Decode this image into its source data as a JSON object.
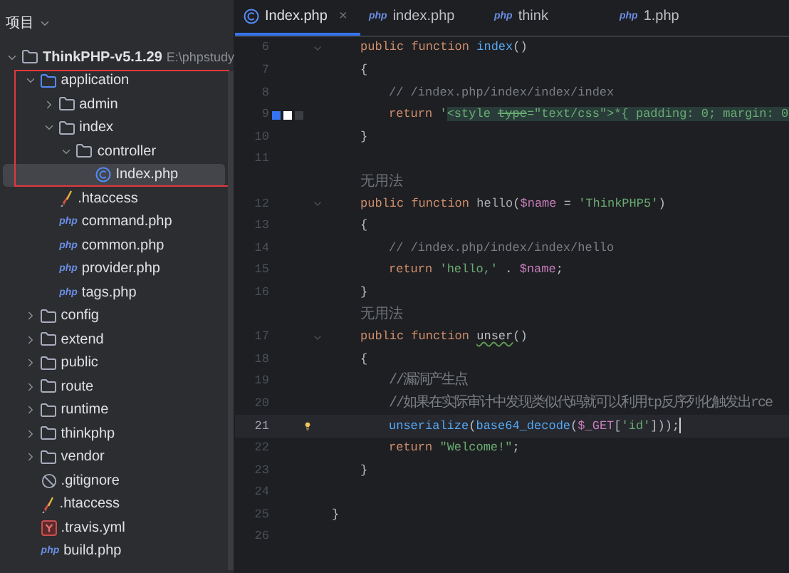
{
  "project_panel": {
    "title": "项目"
  },
  "tree": [
    {
      "label": "ThinkPHP-v5.1.29",
      "path": "E:\\phpstudy",
      "kind": "folder",
      "expanded": true,
      "children": [
        {
          "label": "application",
          "kind": "module",
          "expanded": true,
          "children": [
            {
              "label": "admin",
              "kind": "folder",
              "expanded": false
            },
            {
              "label": "index",
              "kind": "folder",
              "expanded": true,
              "children": [
                {
                  "label": "controller",
                  "kind": "folder",
                  "expanded": true,
                  "children": [
                    {
                      "label": "Index.php",
                      "kind": "class",
                      "selected": true
                    }
                  ]
                }
              ]
            },
            {
              "label": ".htaccess",
              "kind": "htaccess",
              "selected": false
            },
            {
              "label": "command.php",
              "kind": "php",
              "icon_label": "php",
              "selected": false
            },
            {
              "label": "common.php",
              "kind": "php",
              "icon_label": "php",
              "selected": false
            },
            {
              "label": "provider.php",
              "kind": "php",
              "icon_label": "php",
              "selected": false
            },
            {
              "label": "tags.php",
              "kind": "php",
              "icon_label": "php",
              "selected": false
            }
          ]
        },
        {
          "label": "config",
          "kind": "folder",
          "expanded": false
        },
        {
          "label": "extend",
          "kind": "folder",
          "expanded": false
        },
        {
          "label": "public",
          "kind": "folder",
          "expanded": false
        },
        {
          "label": "route",
          "kind": "folder",
          "expanded": false
        },
        {
          "label": "runtime",
          "kind": "folder",
          "expanded": false
        },
        {
          "label": "thinkphp",
          "kind": "folder",
          "expanded": false
        },
        {
          "label": "vendor",
          "kind": "folder",
          "expanded": false
        },
        {
          "label": ".gitignore",
          "kind": "gitignore",
          "selected": false
        },
        {
          "label": ".htaccess",
          "kind": "htaccess",
          "selected": false
        },
        {
          "label": ".travis.yml",
          "kind": "yml",
          "selected": false
        },
        {
          "label": "build.php",
          "kind": "php",
          "icon_label": "php",
          "selected": false
        }
      ]
    }
  ],
  "tabs": [
    {
      "label": "Index.php",
      "kind": "class",
      "selected": true,
      "close": "×"
    },
    {
      "label": "index.php",
      "kind": "php",
      "icon_label": "php",
      "selected": false
    },
    {
      "label": "think",
      "kind": "php",
      "icon_label": "php",
      "selected": false
    },
    {
      "label": "1.php",
      "kind": "php",
      "icon_label": "php",
      "selected": false
    }
  ],
  "code": [
    {
      "kind": "member",
      "number": "6",
      "fold": true,
      "tokens": [
        {
          "text": "public function ",
          "kind": "kw"
        },
        {
          "text": "index",
          "kind": "fn"
        },
        {
          "text": "()",
          "kind": "plain"
        }
      ]
    },
    {
      "kind": "member",
      "number": "7",
      "tokens": [
        {
          "text": "{",
          "kind": "plain"
        }
      ]
    },
    {
      "kind": "body",
      "number": "8",
      "tokens": [
        {
          "text": "// /index.php/index/index/index",
          "kind": "cmt"
        }
      ]
    },
    {
      "kind": "body",
      "number": "9",
      "gutter": {
        "kind": "swatches"
      },
      "tokens": [
        {
          "text": "return ",
          "kind": "kw"
        },
        {
          "text": "'",
          "kind": "str"
        },
        {
          "text": "<style ",
          "kind": "markup"
        },
        {
          "text": "type",
          "kind": "deprecated"
        },
        {
          "text": "=\"text/css\">*{ padding: 0; margin: 0",
          "kind": "markup"
        }
      ]
    },
    {
      "kind": "member",
      "number": "10",
      "tokens": [
        {
          "text": "}",
          "kind": "plain"
        }
      ]
    },
    {
      "number": "11"
    },
    {
      "kind": "hint",
      "tokens": [
        {
          "text": "无用法",
          "kind": "hint"
        }
      ]
    },
    {
      "kind": "member",
      "number": "12",
      "fold": true,
      "tokens": [
        {
          "text": "public function ",
          "kind": "kw"
        },
        {
          "text": "hello",
          "kind": "unused"
        },
        {
          "text": "(",
          "kind": "plain"
        },
        {
          "text": "$name",
          "kind": "var"
        },
        {
          "text": " = ",
          "kind": "plain"
        },
        {
          "text": "'ThinkPHP5'",
          "kind": "str"
        },
        {
          "text": ")",
          "kind": "plain"
        }
      ]
    },
    {
      "kind": "member",
      "number": "13",
      "tokens": [
        {
          "text": "{",
          "kind": "plain"
        }
      ]
    },
    {
      "kind": "body",
      "number": "14",
      "tokens": [
        {
          "text": "// /index.php/index/index/hello",
          "kind": "cmt"
        }
      ]
    },
    {
      "kind": "body",
      "number": "15",
      "tokens": [
        {
          "text": "return ",
          "kind": "kw"
        },
        {
          "text": "'hello,'",
          "kind": "str"
        },
        {
          "text": " . ",
          "kind": "plain"
        },
        {
          "text": "$name",
          "kind": "var"
        },
        {
          "text": ";",
          "kind": "plain"
        }
      ]
    },
    {
      "kind": "member",
      "number": "16",
      "tokens": [
        {
          "text": "}",
          "kind": "plain"
        }
      ]
    },
    {
      "kind": "hint",
      "tokens": [
        {
          "text": "无用法",
          "kind": "hint"
        }
      ]
    },
    {
      "kind": "member",
      "number": "17",
      "fold": true,
      "tokens": [
        {
          "text": "public function ",
          "kind": "kw"
        },
        {
          "text": "unser",
          "kind": "warn"
        },
        {
          "text": "()",
          "kind": "plain"
        }
      ]
    },
    {
      "kind": "member",
      "number": "18",
      "tokens": [
        {
          "text": "{",
          "kind": "plain"
        }
      ]
    },
    {
      "kind": "body",
      "number": "19",
      "tokens": [
        {
          "text": "//漏洞产生点",
          "kind": "note"
        }
      ]
    },
    {
      "kind": "body",
      "number": "20",
      "tokens": [
        {
          "text": "//如果在实际审计中发现类似代码就可以利用tp反序列化触发出rce",
          "kind": "note"
        }
      ]
    },
    {
      "kind": "body",
      "number": "21",
      "current": true,
      "gutter": {
        "kind": "bulb"
      },
      "tokens": [
        {
          "text": "unserialize",
          "kind": "call"
        },
        {
          "text": "(",
          "kind": "plain"
        },
        {
          "text": "base64_decode",
          "kind": "call"
        },
        {
          "text": "(",
          "kind": "plain"
        },
        {
          "text": "$_GET",
          "kind": "var"
        },
        {
          "text": "[",
          "kind": "plain"
        },
        {
          "text": "'id'",
          "kind": "str"
        },
        {
          "text": "]));",
          "kind": "plain"
        }
      ]
    },
    {
      "kind": "body",
      "number": "22",
      "tokens": [
        {
          "text": "return ",
          "kind": "kw"
        },
        {
          "text": "\"Welcome!\"",
          "kind": "str"
        },
        {
          "text": ";",
          "kind": "plain"
        }
      ]
    },
    {
      "kind": "member",
      "number": "23",
      "tokens": [
        {
          "text": "}",
          "kind": "plain"
        }
      ]
    },
    {
      "number": "24"
    },
    {
      "kind": "top",
      "number": "25",
      "tokens": [
        {
          "text": "}",
          "kind": "plain"
        }
      ]
    },
    {
      "number": "26"
    }
  ]
}
